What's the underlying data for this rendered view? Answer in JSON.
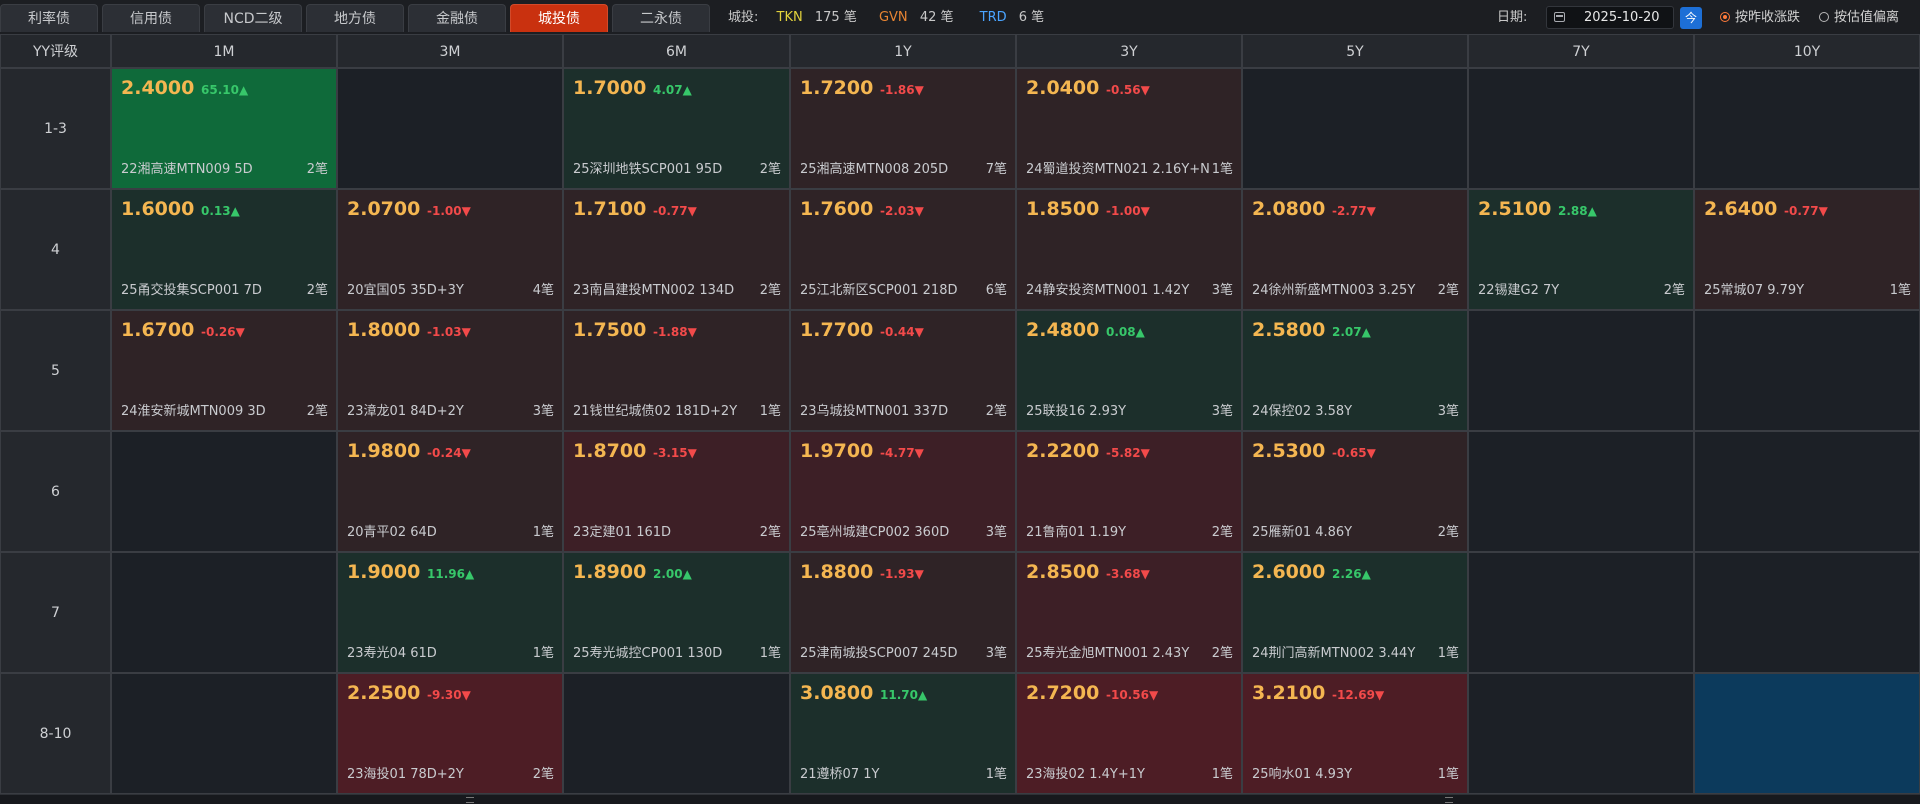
{
  "tabs": [
    {
      "label": "利率债",
      "active": false
    },
    {
      "label": "信用债",
      "active": false
    },
    {
      "label": "NCD二级",
      "active": false
    },
    {
      "label": "地方债",
      "active": false
    },
    {
      "label": "金融债",
      "active": false
    },
    {
      "label": "城投债",
      "active": true
    },
    {
      "label": "二永债",
      "active": false
    }
  ],
  "summary": {
    "label": "城投:",
    "tkn": {
      "tag": "TKN",
      "count": "175 笔"
    },
    "gvn": {
      "tag": "GVN",
      "count": "42 笔"
    },
    "trd": {
      "tag": "TRD",
      "count": "6 笔"
    }
  },
  "date": {
    "label": "日期:",
    "value": "2025-10-20",
    "today": "今"
  },
  "sort_options": [
    {
      "label": "按昨收涨跌",
      "selected": true
    },
    {
      "label": "按估值偏离",
      "selected": false
    }
  ],
  "grid": {
    "corner": "YY评级",
    "columns": [
      "1M",
      "3M",
      "6M",
      "1Y",
      "3Y",
      "5Y",
      "7Y",
      "10Y"
    ],
    "rows": [
      {
        "label": "1-3",
        "cells": [
          {
            "yield": "2.4000",
            "chg": "65.10▲",
            "dir": "up",
            "tone": "strong",
            "bond": "22湘高速MTN009 5D",
            "trades": "2笔"
          },
          null,
          {
            "yield": "1.7000",
            "chg": "4.07▲",
            "dir": "up",
            "bond": "25深圳地铁SCP001 95D",
            "trades": "2笔"
          },
          {
            "yield": "1.7200",
            "chg": "-1.86▼",
            "dir": "down",
            "bond": "25湘高速MTN008 205D",
            "trades": "7笔"
          },
          {
            "yield": "2.0400",
            "chg": "-0.56▼",
            "dir": "down",
            "bond": "24蜀道投资MTN021 2.16Y+N",
            "trades": "1笔"
          },
          null,
          null,
          null
        ]
      },
      {
        "label": "4",
        "cells": [
          {
            "yield": "1.6000",
            "chg": "0.13▲",
            "dir": "up",
            "bond": "25甬交投集SCP001 7D",
            "trades": "2笔"
          },
          {
            "yield": "2.0700",
            "chg": "-1.00▼",
            "dir": "down",
            "bond": "20宜国05 35D+3Y",
            "trades": "4笔"
          },
          {
            "yield": "1.7100",
            "chg": "-0.77▼",
            "dir": "down",
            "bond": "23南昌建投MTN002 134D",
            "trades": "2笔"
          },
          {
            "yield": "1.7600",
            "chg": "-2.03▼",
            "dir": "down",
            "bond": "25江北新区SCP001 218D",
            "trades": "6笔"
          },
          {
            "yield": "1.8500",
            "chg": "-1.00▼",
            "dir": "down",
            "bond": "24静安投资MTN001 1.42Y",
            "trades": "3笔"
          },
          {
            "yield": "2.0800",
            "chg": "-2.77▼",
            "dir": "down",
            "bond": "24徐州新盛MTN003 3.25Y",
            "trades": "2笔"
          },
          {
            "yield": "2.5100",
            "chg": "2.88▲",
            "dir": "up",
            "bond": "22锡建G2 7Y",
            "trades": "2笔"
          },
          {
            "yield": "2.6400",
            "chg": "-0.77▼",
            "dir": "down",
            "bond": "25常城07 9.79Y",
            "trades": "1笔"
          }
        ]
      },
      {
        "label": "5",
        "cells": [
          {
            "yield": "1.6700",
            "chg": "-0.26▼",
            "dir": "down",
            "bond": "24淮安新城MTN009 3D",
            "trades": "2笔"
          },
          {
            "yield": "1.8000",
            "chg": "-1.03▼",
            "dir": "down",
            "bond": "23漳龙01 84D+2Y",
            "trades": "3笔"
          },
          {
            "yield": "1.7500",
            "chg": "-1.88▼",
            "dir": "down",
            "bond": "21钱世纪城债02 181D+2Y",
            "trades": "1笔"
          },
          {
            "yield": "1.7700",
            "chg": "-0.44▼",
            "dir": "down",
            "bond": "23乌城投MTN001 337D",
            "trades": "2笔"
          },
          {
            "yield": "2.4800",
            "chg": "0.08▲",
            "dir": "up",
            "bond": "25联投16 2.93Y",
            "trades": "3笔"
          },
          {
            "yield": "2.5800",
            "chg": "2.07▲",
            "dir": "up",
            "bond": "24保控02 3.58Y",
            "trades": "3笔"
          },
          null,
          null
        ]
      },
      {
        "label": "6",
        "cells": [
          null,
          {
            "yield": "1.9800",
            "chg": "-0.24▼",
            "dir": "down",
            "bond": "20青平02 64D",
            "trades": "1笔"
          },
          {
            "yield": "1.8700",
            "chg": "-3.15▼",
            "dir": "down",
            "tone": "mid",
            "bond": "23定建01 161D",
            "trades": "2笔"
          },
          {
            "yield": "1.9700",
            "chg": "-4.77▼",
            "dir": "down",
            "tone": "mid",
            "bond": "25亳州城建CP002 360D",
            "trades": "3笔"
          },
          {
            "yield": "2.2200",
            "chg": "-5.82▼",
            "dir": "down",
            "tone": "mid",
            "bond": "21鲁南01 1.19Y",
            "trades": "2笔"
          },
          {
            "yield": "2.5300",
            "chg": "-0.65▼",
            "dir": "down",
            "bond": "25雁新01 4.86Y",
            "trades": "2笔"
          },
          null,
          null
        ]
      },
      {
        "label": "7",
        "cells": [
          null,
          {
            "yield": "1.9000",
            "chg": "11.96▲",
            "dir": "up",
            "bond": "23寿光04 61D",
            "trades": "1笔"
          },
          {
            "yield": "1.8900",
            "chg": "2.00▲",
            "dir": "up",
            "bond": "25寿光城控CP001 130D",
            "trades": "1笔"
          },
          {
            "yield": "1.8800",
            "chg": "-1.93▼",
            "dir": "down",
            "bond": "25津南城投SCP007 245D",
            "trades": "3笔"
          },
          {
            "yield": "2.8500",
            "chg": "-3.68▼",
            "dir": "down",
            "tone": "mid",
            "bond": "25寿光金旭MTN001 2.43Y",
            "trades": "2笔"
          },
          {
            "yield": "2.6000",
            "chg": "2.26▲",
            "dir": "up",
            "bond": "24荆门高新MTN002 3.44Y",
            "trades": "1笔"
          },
          null,
          null
        ]
      },
      {
        "label": "8-10",
        "cells": [
          null,
          {
            "yield": "2.2500",
            "chg": "-9.30▼",
            "dir": "down",
            "tone": "strong",
            "bond": "23海投01 78D+2Y",
            "trades": "2笔"
          },
          null,
          {
            "yield": "3.0800",
            "chg": "11.70▲",
            "dir": "up",
            "bond": "21遵桥07 1Y",
            "trades": "1笔"
          },
          {
            "yield": "2.7200",
            "chg": "-10.56▼",
            "dir": "down",
            "tone": "strong",
            "bond": "23海投02 1.4Y+1Y",
            "trades": "1笔"
          },
          {
            "yield": "3.2100",
            "chg": "-12.69▼",
            "dir": "down",
            "tone": "strong",
            "bond": "25响水01 4.93Y",
            "trades": "1笔"
          },
          null,
          {
            "highlight": "blue"
          }
        ]
      }
    ]
  },
  "colors": {
    "accent_tab": "#c9310f",
    "up": "#37c76a",
    "down": "#f24a4a",
    "yield": "#f4b651",
    "blue_highlight": "#0c3a5c"
  },
  "icons": {
    "calendar": "calendar-icon"
  }
}
